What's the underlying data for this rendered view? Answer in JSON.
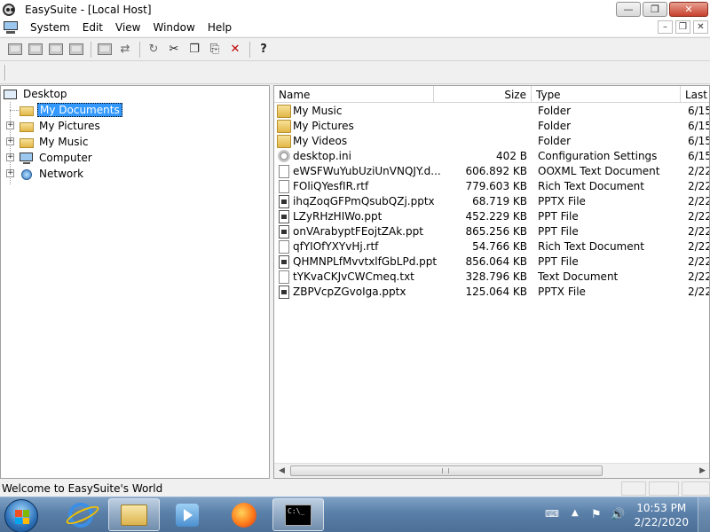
{
  "window": {
    "title": "EasySuite - [Local Host]"
  },
  "menu": [
    "System",
    "Edit",
    "View",
    "Window",
    "Help"
  ],
  "tree": {
    "root": "Desktop",
    "items": [
      {
        "label": "My Documents",
        "selected": true,
        "expandable": false
      },
      {
        "label": "My Pictures",
        "selected": false,
        "expandable": true
      },
      {
        "label": "My Music",
        "selected": false,
        "expandable": true
      },
      {
        "label": "Computer",
        "selected": false,
        "expandable": true
      },
      {
        "label": "Network",
        "selected": false,
        "expandable": true
      }
    ]
  },
  "filelist": {
    "columns": [
      "Name",
      "Size",
      "Type",
      "Last"
    ],
    "rows": [
      {
        "name": "My Music",
        "size": "",
        "type": "Folder",
        "last": "6/15",
        "icon": "folder-icon"
      },
      {
        "name": "My Pictures",
        "size": "",
        "type": "Folder",
        "last": "6/15",
        "icon": "folder-icon"
      },
      {
        "name": "My Videos",
        "size": "",
        "type": "Folder",
        "last": "6/15",
        "icon": "folder-icon"
      },
      {
        "name": "desktop.ini",
        "size": "402 B",
        "type": "Configuration Settings",
        "last": "6/15",
        "icon": "settings-file-icon"
      },
      {
        "name": "eWSFWuYubUziUnVNQJY.d...",
        "size": "606.892 KB",
        "type": "OOXML Text Document",
        "last": "2/22",
        "icon": "document-icon"
      },
      {
        "name": "FOliQYesfIR.rtf",
        "size": "779.603 KB",
        "type": "Rich Text Document",
        "last": "2/22",
        "icon": "document-icon"
      },
      {
        "name": "ihqZoqGFPmQsubQZj.pptx",
        "size": "68.719 KB",
        "type": "PPTX File",
        "last": "2/22",
        "icon": "presentation-icon"
      },
      {
        "name": "LZyRHzHIWo.ppt",
        "size": "452.229 KB",
        "type": "PPT File",
        "last": "2/22",
        "icon": "presentation-icon"
      },
      {
        "name": "onVArabyptFEojtZAk.ppt",
        "size": "865.256 KB",
        "type": "PPT File",
        "last": "2/22",
        "icon": "presentation-icon"
      },
      {
        "name": "qfYIOfYXYvHj.rtf",
        "size": "54.766 KB",
        "type": "Rich Text Document",
        "last": "2/22",
        "icon": "document-icon"
      },
      {
        "name": "QHMNPLfMvvtxlfGbLPd.ppt",
        "size": "856.064 KB",
        "type": "PPT File",
        "last": "2/22",
        "icon": "presentation-icon"
      },
      {
        "name": "tYKvaCKJvCWCmeq.txt",
        "size": "328.796 KB",
        "type": "Text Document",
        "last": "2/22",
        "icon": "document-icon"
      },
      {
        "name": "ZBPVcpZGvoIga.pptx",
        "size": "125.064 KB",
        "type": "PPTX File",
        "last": "2/22",
        "icon": "presentation-icon"
      }
    ]
  },
  "status": {
    "text": "Welcome to EasySuite's World"
  },
  "taskbar": {
    "clock_time": "10:53 PM",
    "clock_date": "2/22/2020"
  }
}
